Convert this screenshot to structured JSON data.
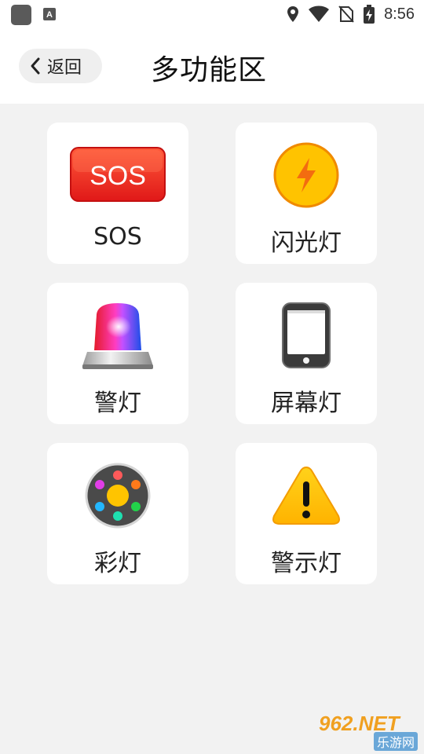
{
  "status_bar": {
    "time": "8:56"
  },
  "header": {
    "back_label": "返回",
    "title": "多功能区"
  },
  "grid": {
    "items": [
      {
        "label": "SOS",
        "icon": "sos-icon",
        "icon_text": "SOS"
      },
      {
        "label": "闪光灯",
        "icon": "lightning-icon"
      },
      {
        "label": "警灯",
        "icon": "siren-icon"
      },
      {
        "label": "屏幕灯",
        "icon": "phone-icon"
      },
      {
        "label": "彩灯",
        "icon": "color-light-icon"
      },
      {
        "label": "警示灯",
        "icon": "warning-icon"
      }
    ]
  },
  "watermark": {
    "top": "962.NET",
    "bottom": "乐游网"
  },
  "colors": {
    "sos_red": "#f0302a",
    "flash_yellow": "#ffc300",
    "warning_yellow": "#ffc200",
    "background": "#f2f2f2"
  }
}
